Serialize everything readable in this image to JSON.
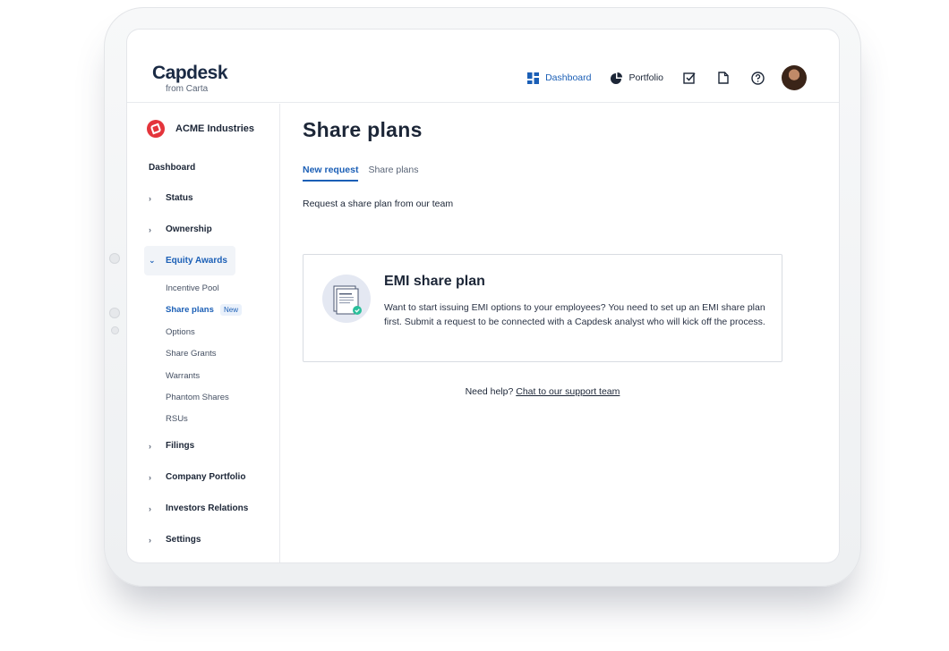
{
  "brand": {
    "name": "Capdesk",
    "sub": "from Carta"
  },
  "topnav": {
    "dashboard_label": "Dashboard",
    "portfolio_label": "Portfolio"
  },
  "sidebar": {
    "company": "ACME Industries",
    "dashboard": "Dashboard",
    "items": [
      {
        "label": "Status"
      },
      {
        "label": "Ownership"
      },
      {
        "label": "Equity Awards",
        "open": true
      },
      {
        "label": "Filings"
      },
      {
        "label": "Company Portfolio"
      },
      {
        "label": "Investors Relations"
      },
      {
        "label": "Settings"
      }
    ],
    "sub_items": [
      {
        "label": "Incentive Pool"
      },
      {
        "label": "Share plans",
        "active": true,
        "badge": "New"
      },
      {
        "label": "Options"
      },
      {
        "label": "Share Grants"
      },
      {
        "label": "Warrants"
      },
      {
        "label": "Phantom Shares"
      },
      {
        "label": "RSUs"
      }
    ]
  },
  "main": {
    "title": "Share plans",
    "tabs": [
      {
        "label": "New request",
        "active": true
      },
      {
        "label": "Share plans"
      }
    ],
    "intro": "Request a share plan from our team",
    "card": {
      "title": "EMI share plan",
      "text": "Want to start issuing EMI options to your employees? You need to set up an EMI share plan first. Submit a request to be connected with a Capdesk analyst who will kick off the process."
    },
    "help": {
      "text": "Need help?",
      "link": "Chat to our support team"
    }
  },
  "colors": {
    "accent": "#1b5fb6",
    "brand_red": "#e4343b",
    "text": "#1c2637"
  }
}
